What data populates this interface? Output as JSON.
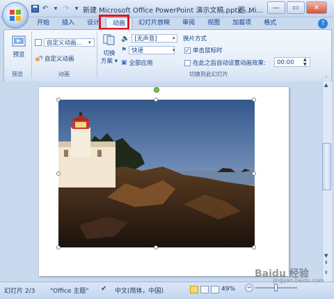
{
  "window": {
    "title": "新建 Microsoft Office PowerPoint 演示文稿.pptx - Mi...",
    "title_suffix": "图..."
  },
  "tabs": [
    {
      "label": "开始"
    },
    {
      "label": "插入"
    },
    {
      "label": "设计"
    },
    {
      "label": "动画",
      "active": true
    },
    {
      "label": "幻灯片放映"
    },
    {
      "label": "审阅"
    },
    {
      "label": "视图"
    },
    {
      "label": "加载项"
    },
    {
      "label": "格式"
    }
  ],
  "ribbon": {
    "preview": {
      "button": "预览",
      "group": "预览"
    },
    "animation": {
      "custom_dropdown": "自定义动画...",
      "custom_button": "自定义动画",
      "group": "动画"
    },
    "transition": {
      "scheme_label_1": "切换",
      "scheme_label_2": "方案",
      "sound_value": "[无声音]",
      "speed_value": "快速",
      "apply_all": "全部应用",
      "advance_heading": "换片方式",
      "on_click": "单击鼠标时",
      "after_time": "在此之后自动设置动画效果:",
      "time_value": "00:00",
      "group": "切换到此幻灯片"
    }
  },
  "status": {
    "slide": "幻灯片 2/3",
    "theme": "\"Office 主题\"",
    "language": "中文(简体，中国)",
    "zoom": "49%",
    "zoom_fraction": 0.49
  },
  "watermark": {
    "main": "Baidu 经验",
    "sub": "jingyan.baidu.com"
  },
  "colors": {
    "accent_red": "#e0161e",
    "ribbon_bg": "#e4edf8",
    "workspace": "#c9d9ee"
  }
}
